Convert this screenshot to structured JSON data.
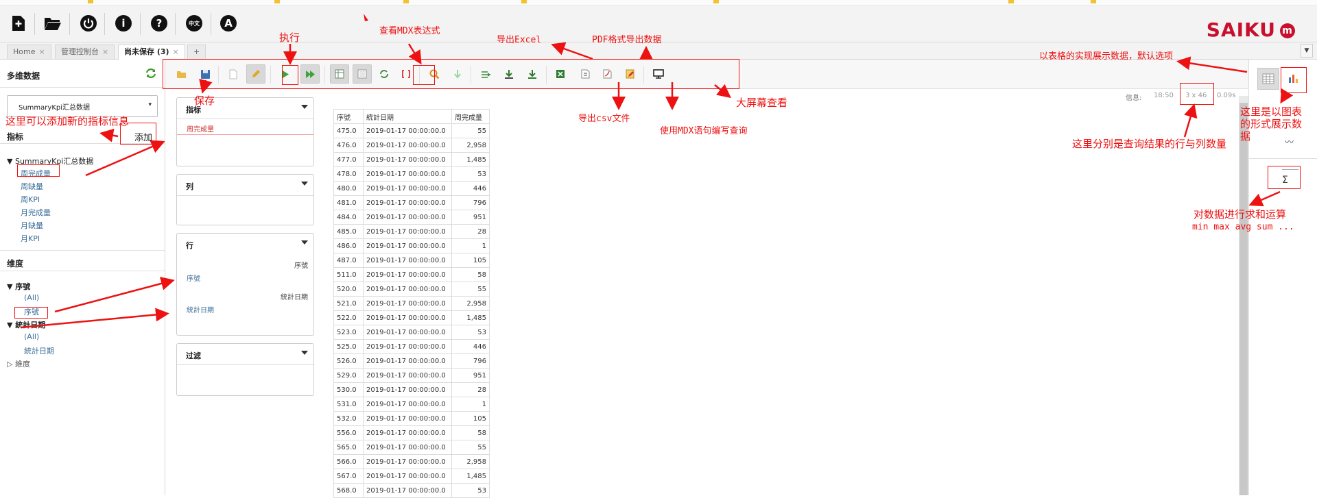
{
  "toolbar": {
    "icons": [
      "new-query-icon",
      "open-folder-icon",
      "power-icon",
      "info-icon",
      "help-icon",
      "globe-language-icon",
      "admin-icon"
    ],
    "globe_text": "中文",
    "admin_letter": "A"
  },
  "logo": {
    "text": "SAIKU",
    "mark": "m"
  },
  "tabs": [
    {
      "label": "Home",
      "close": "×"
    },
    {
      "label": "管理控制台",
      "close": "×"
    },
    {
      "label": "尚未保存 (3)",
      "close": "×"
    },
    {
      "label": "+"
    }
  ],
  "tab_dropdown": "▼",
  "left": {
    "title": "多维数据",
    "cube_value": "SummaryKpi汇总数据",
    "measures_title": "指标",
    "measures_group": "SummaryKpi汇总数据",
    "measures": [
      "周完成量",
      "周缺量",
      "周KPI",
      "月完成量",
      "月缺量",
      "月KPI"
    ],
    "dimensions_title": "维度",
    "dimensions": [
      {
        "name": "序號",
        "children": [
          "(All)",
          "序號"
        ]
      },
      {
        "name": "統計日期",
        "children": [
          "(All)",
          "統計日期"
        ]
      }
    ],
    "collapsed_dimension": "維度"
  },
  "zones": {
    "measures": {
      "title": "指标",
      "items": [
        "周完成量"
      ]
    },
    "columns": {
      "title": "列"
    },
    "rows": {
      "title": "行",
      "items": [
        {
          "hint": "序號",
          "label": "序號"
        },
        {
          "hint": "統計日期",
          "label": "統計日期"
        }
      ]
    },
    "filter": {
      "title": "过滤"
    }
  },
  "info": {
    "label": "信息:",
    "time": "18:50",
    "size": "3 x 46",
    "duration": "0.09s"
  },
  "table": {
    "headers": [
      "序號",
      "統計日期",
      "周完成量"
    ],
    "rows": [
      [
        "475.0",
        "2019-01-17 00:00:00.0",
        "55"
      ],
      [
        "476.0",
        "2019-01-17 00:00:00.0",
        "2,958"
      ],
      [
        "477.0",
        "2019-01-17 00:00:00.0",
        "1,485"
      ],
      [
        "478.0",
        "2019-01-17 00:00:00.0",
        "53"
      ],
      [
        "480.0",
        "2019-01-17 00:00:00.0",
        "446"
      ],
      [
        "481.0",
        "2019-01-17 00:00:00.0",
        "796"
      ],
      [
        "484.0",
        "2019-01-17 00:00:00.0",
        "951"
      ],
      [
        "485.0",
        "2019-01-17 00:00:00.0",
        "28"
      ],
      [
        "486.0",
        "2019-01-17 00:00:00.0",
        "1"
      ],
      [
        "487.0",
        "2019-01-17 00:00:00.0",
        "105"
      ],
      [
        "511.0",
        "2019-01-17 00:00:00.0",
        "58"
      ],
      [
        "520.0",
        "2019-01-17 00:00:00.0",
        "55"
      ],
      [
        "521.0",
        "2019-01-17 00:00:00.0",
        "2,958"
      ],
      [
        "522.0",
        "2019-01-17 00:00:00.0",
        "1,485"
      ],
      [
        "523.0",
        "2019-01-17 00:00:00.0",
        "53"
      ],
      [
        "525.0",
        "2019-01-17 00:00:00.0",
        "446"
      ],
      [
        "526.0",
        "2019-01-17 00:00:00.0",
        "796"
      ],
      [
        "529.0",
        "2019-01-17 00:00:00.0",
        "951"
      ],
      [
        "530.0",
        "2019-01-17 00:00:00.0",
        "28"
      ],
      [
        "531.0",
        "2019-01-17 00:00:00.0",
        "1"
      ],
      [
        "532.0",
        "2019-01-17 00:00:00.0",
        "105"
      ],
      [
        "556.0",
        "2019-01-17 00:00:00.0",
        "58"
      ],
      [
        "565.0",
        "2019-01-17 00:00:00.0",
        "55"
      ],
      [
        "566.0",
        "2019-01-17 00:00:00.0",
        "2,958"
      ],
      [
        "567.0",
        "2019-01-17 00:00:00.0",
        "1,485"
      ],
      [
        "568.0",
        "2019-01-17 00:00:00.0",
        "53"
      ]
    ]
  },
  "right": {
    "sigma": "Σ",
    "sparkline": "〰"
  },
  "annotations": {
    "execute": "执行",
    "view_mdx": "查看MDX表达式",
    "export_excel": "导出Excel",
    "export_pdf": "PDF格式导出数据",
    "table_default": "以表格的实现展示数据，默认选项",
    "save": "保存",
    "add_measure_hint": "这里可以添加新的指标信息",
    "add": "添加",
    "export_csv": "导出csv文件",
    "fullscreen": "大屏幕查看",
    "mdx_edit": "使用MDX语句编写查询",
    "row_col_count": "这里分别是查询结果的行与列数量",
    "chart_display": "这里是以图表的形式展示数据",
    "sum_ops": "对数据进行求和运算",
    "sum_ops_list": "min  max avg sum ..."
  },
  "colors": {
    "annotation": "#ee1111",
    "brand": "#c8102e"
  }
}
